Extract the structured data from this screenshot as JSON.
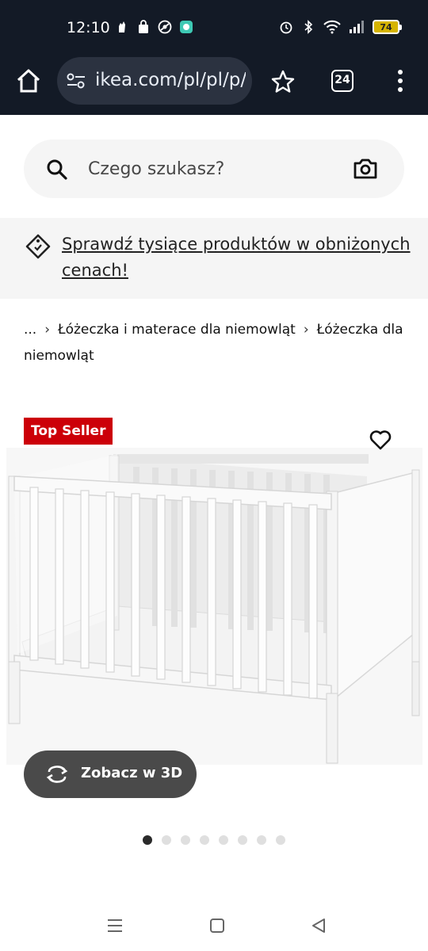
{
  "status_bar": {
    "time": "12:10",
    "battery": "74",
    "left_icons": [
      "hand-icon",
      "shopping-bag-icon",
      "no-tracking-icon",
      "chat-app-icon"
    ],
    "right_icons": [
      "alarm-icon",
      "bluetooth-icon",
      "wifi-icon",
      "signal-icon",
      "battery-icon"
    ]
  },
  "browser": {
    "url": "ikea.com/pl/pl/p/s",
    "tab_count": "24"
  },
  "search": {
    "placeholder": "Czego szukasz?"
  },
  "promo": {
    "text": "Sprawdź tysiące produktów w obniżonych cenach!"
  },
  "breadcrumb": {
    "items": [
      "...",
      "Łóżeczka i materace dla niemowląt",
      "Łóżeczka dla niemowląt"
    ]
  },
  "product": {
    "badge": "Top Seller",
    "view_3d_label": "Zobacz w 3D",
    "image_count": 8,
    "active_image": 1,
    "badge_color": "#cc0008"
  },
  "android_nav": {
    "items": [
      "recents",
      "home",
      "back"
    ]
  }
}
